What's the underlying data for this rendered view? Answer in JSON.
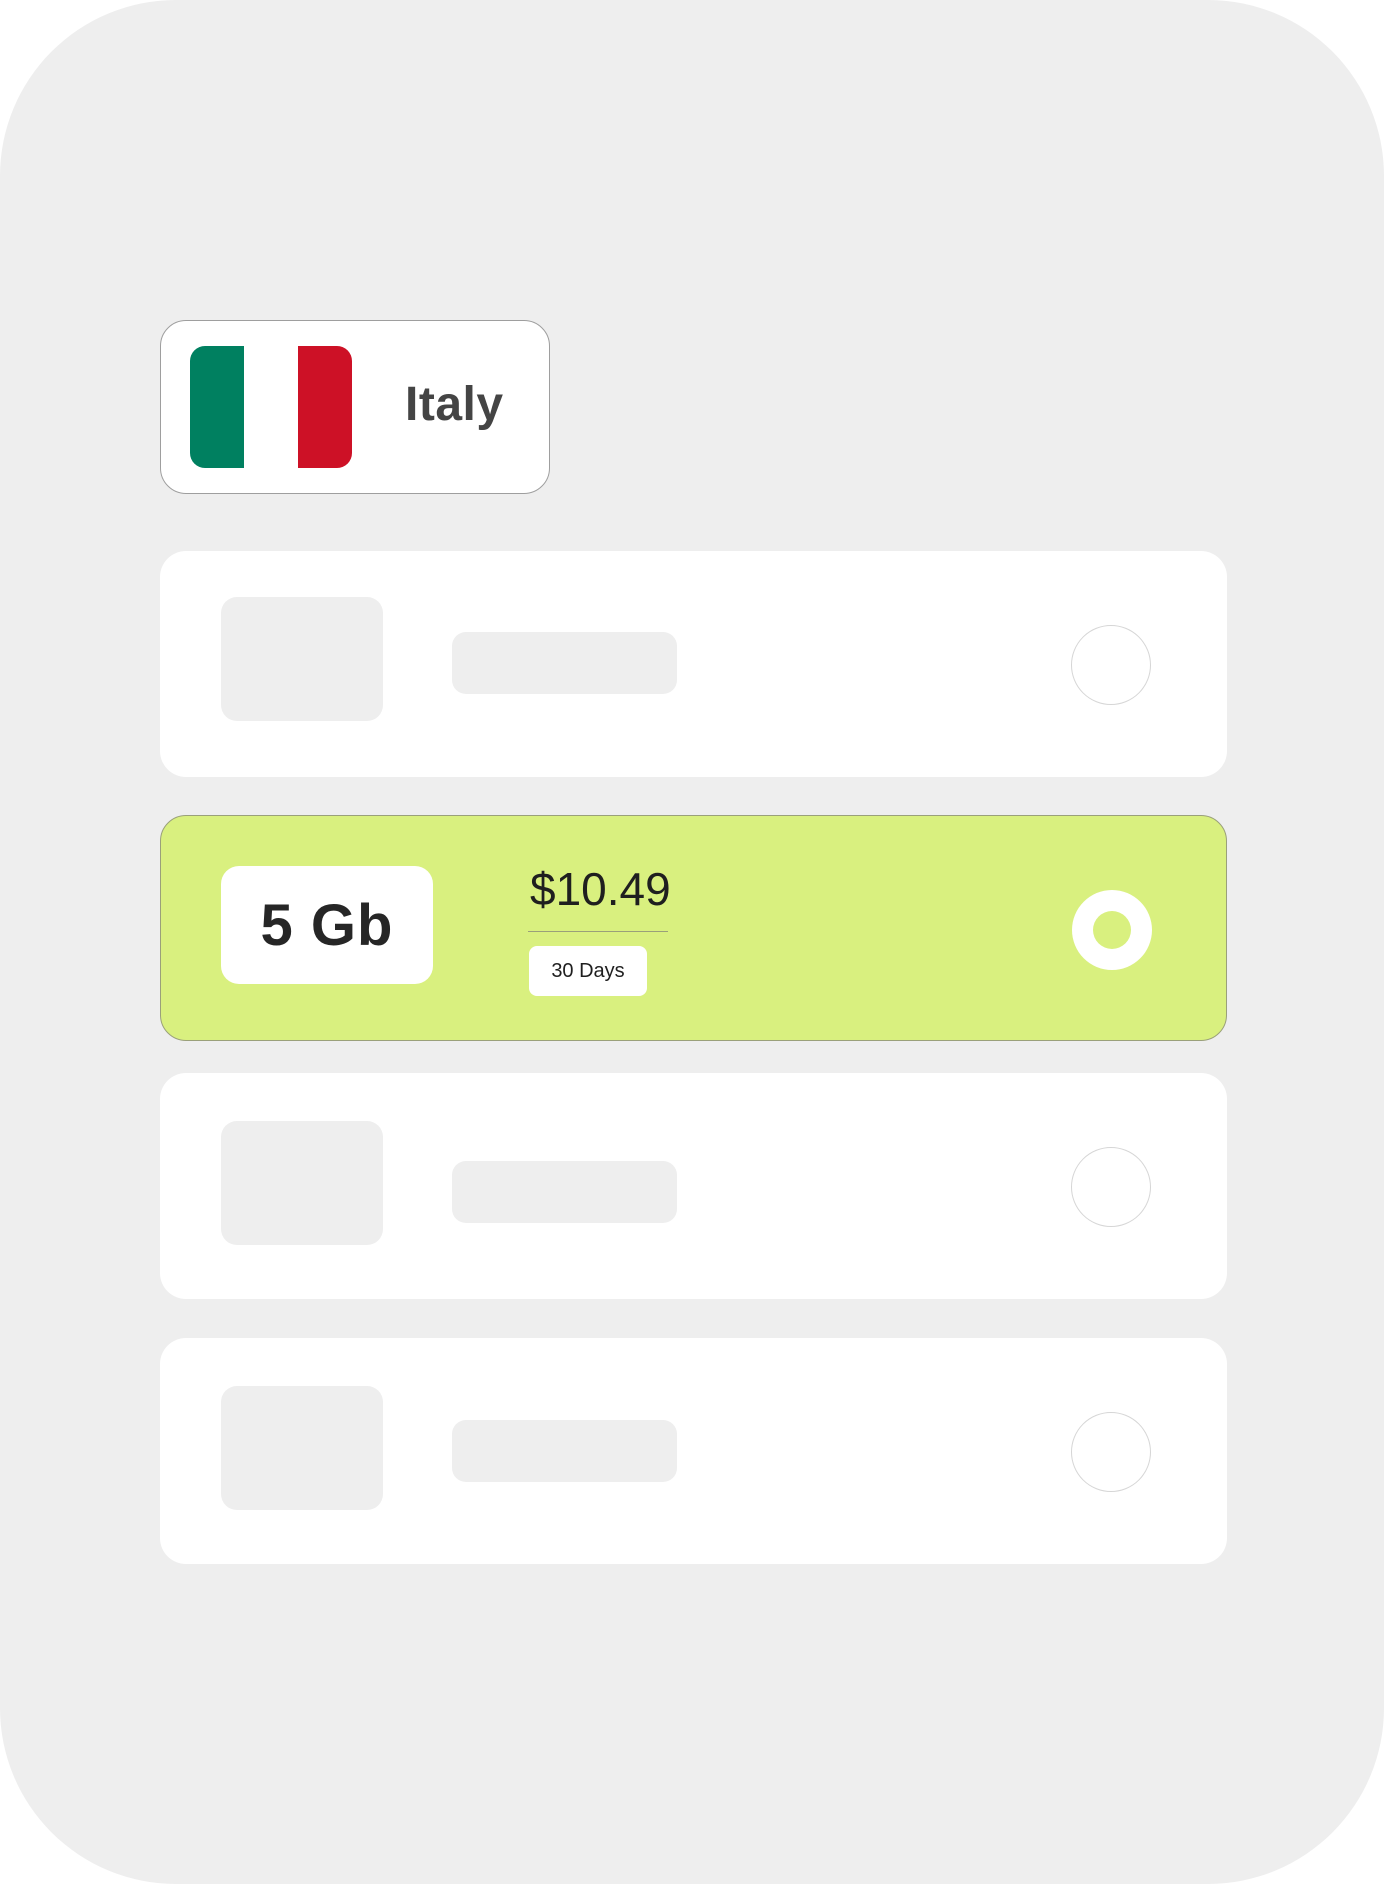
{
  "country": {
    "name": "Italy",
    "flag_colors": [
      "#008060",
      "#ffffff",
      "#cd1126"
    ]
  },
  "selected_plan": {
    "data_amount": "5 Gb",
    "price": "$10.49",
    "duration": "30 Days",
    "highlight_color": "#d9f07f"
  },
  "plans": [
    {
      "state": "placeholder",
      "selected": false
    },
    {
      "state": "loaded",
      "selected": true
    },
    {
      "state": "placeholder",
      "selected": false
    },
    {
      "state": "placeholder",
      "selected": false
    }
  ]
}
